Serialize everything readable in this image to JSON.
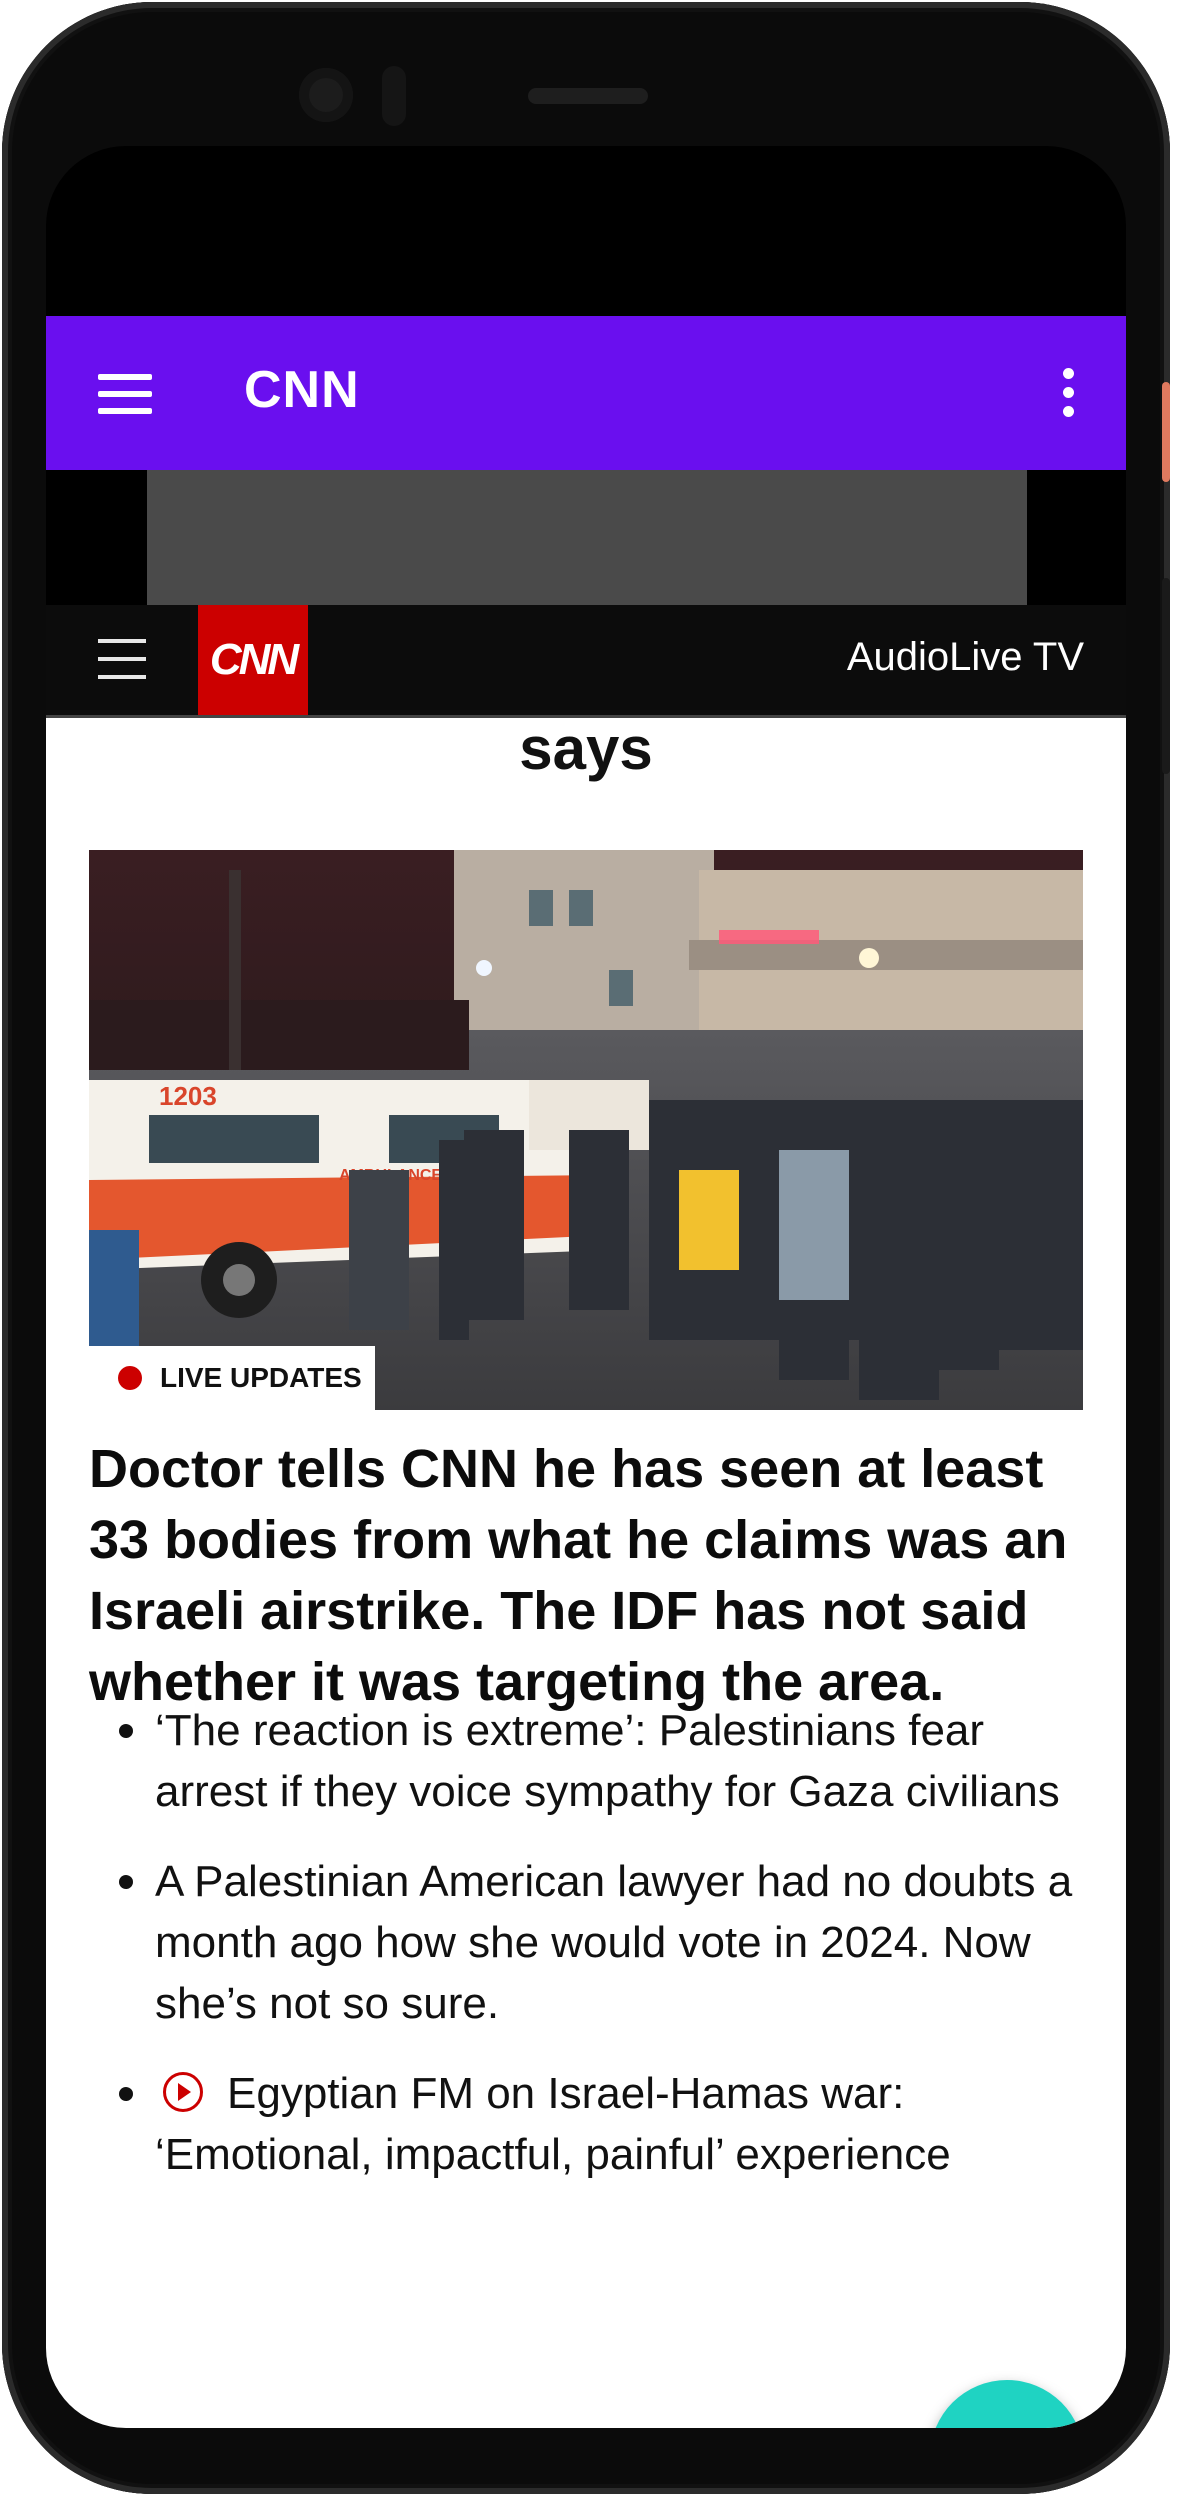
{
  "app_bar": {
    "title": "CNN",
    "color": "#6a0fef"
  },
  "site_header": {
    "logo_text": "CNN",
    "logo_color": "#cc0000",
    "audio_live_tv": "AudioLive TV"
  },
  "article": {
    "headline_tail": "says",
    "badge": "LIVE UPDATES",
    "story_headline": "Doctor tells CNN he has seen at least 33 bodies from what he claims was an Israeli airstrike. The IDF has not said whether it was targeting the area.",
    "image_alt": "Ambulances and crowd outside hospital at night",
    "bullets": [
      "‘The reaction is extreme’: Palestinians fear arrest if they voice sympathy for Gaza civilians",
      "A Palestinian American lawyer had no doubts a month ago how she would vote in 2024. Now she’s not so sure.",
      "Egyptian FM on Israel-Hamas war: ‘Emotional, impactful, painful’ experience"
    ]
  },
  "fab": {
    "icon": "mail-icon",
    "color": "#1fd3c2"
  }
}
